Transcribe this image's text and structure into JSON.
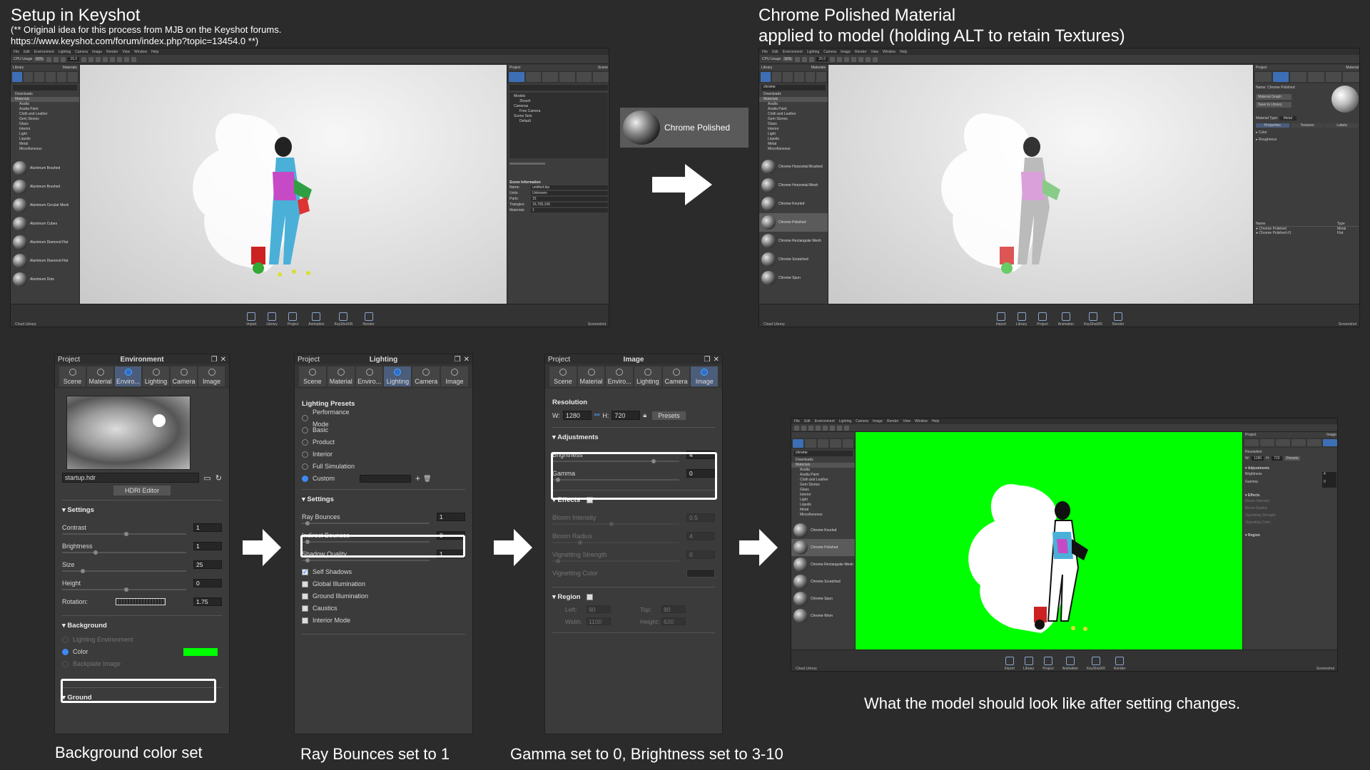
{
  "top_left": {
    "title": "Setup in Keyshot",
    "note_line1": "(** Original idea for this process from MJB on the Keyshot forums.",
    "note_line2": "https://www.keyshot.com/forum/index.php?topic=13454.0  **)"
  },
  "top_right": {
    "title_line1": "Chrome Polished Material",
    "title_line2": "applied to model (holding ALT to retain Textures)"
  },
  "material_chip": {
    "label": "Chrome Polished"
  },
  "app": {
    "menu": [
      "File",
      "Edit",
      "Environment",
      "Lighting",
      "Camera",
      "Image",
      "Render",
      "View",
      "Window",
      "Help"
    ],
    "cpu_label": "CPU Usage",
    "cpu_value": "50%",
    "fps": "25.0",
    "library_label": "Library",
    "materials_label": "Materials",
    "project_label": "Project",
    "scene_label": "Scene",
    "material_tab": "Material",
    "image_tab": "Image",
    "cloud_library": "Cloud Library",
    "screenshot": "Screenshot",
    "bottom_items": [
      "Import",
      "Library",
      "Project",
      "Animation",
      "KeyShotXR",
      "Render"
    ],
    "tree": [
      "Downloads",
      "Materials",
      "Axalta",
      "Axalta Paint",
      "Cloth and Leather",
      "Gem Stones",
      "Glass",
      "Interior",
      "Light",
      "Liquids",
      "Metal",
      "Miscellaneous"
    ],
    "thumbs_left": [
      "Aluminum Brushed",
      "Aluminum Brushed",
      "Aluminum Circular Mesh",
      "Aluminum Cubes",
      "Aluminum Diamond Flat",
      "Aluminum Diamond Flat",
      "Aluminum Dots"
    ],
    "thumbs_right": [
      "Chrome Horizontal Brushed",
      "Chrome Horizontal Mesh",
      "Chrome Knurled",
      "Chrome Polished",
      "Chrome Rectangular Mesh",
      "Chrome Scratched",
      "Chrome Spun"
    ],
    "thumbs_bottom": [
      "Chrome Knurled",
      "Chrome Polished",
      "Chrome Rectangular Mesh",
      "Chrome Scratched",
      "Chrome Spun",
      "Chrome Worn"
    ],
    "search_value": "chrome",
    "scene_info_title": "Scene Information",
    "scene_info": [
      {
        "k": "Name:",
        "v": "untitled.bip"
      },
      {
        "k": "Units:",
        "v": "Unknown"
      },
      {
        "k": "Parts:",
        "v": "15"
      },
      {
        "k": "Triangles:",
        "v": "16,700,106"
      },
      {
        "k": "Materials:",
        "v": "1"
      }
    ],
    "scene_tree": [
      "Models",
      "Zbrush",
      "Cameras",
      "Free Camera",
      "Scene Sets",
      "Default"
    ],
    "mat_name_label": "Name:",
    "mat_name": "Chrome Polished",
    "material_graph": "Material Graph",
    "save_to_library": "Save to Library",
    "material_type_label": "Material Type:",
    "material_type": "Metal",
    "mat_subtabs": [
      "Properties",
      "Textures",
      "Labels"
    ],
    "mat_props": [
      "Color",
      "Roughness"
    ],
    "mat_list_headers": [
      "Name",
      "Type"
    ],
    "mat_list": [
      {
        "name": "Chrome Polished",
        "type": "Metal"
      },
      {
        "name": "Chrome Polished #1",
        "type": "Flat"
      }
    ]
  },
  "environment_panel": {
    "header_left": "Project",
    "title": "Environment",
    "tabs": [
      "Scene",
      "Material",
      "Enviro...",
      "Lighting",
      "Camera",
      "Image"
    ],
    "active_tab": 2,
    "hdri_file": "startup.hdr",
    "hdri_editor": "HDRI Editor",
    "settings_label": "Settings",
    "fields": [
      {
        "label": "Contrast",
        "value": "1"
      },
      {
        "label": "Brightness",
        "value": "1"
      },
      {
        "label": "Size",
        "value": "25"
      },
      {
        "label": "Height",
        "value": "0"
      },
      {
        "label": "Rotation:",
        "value": "1.75"
      }
    ],
    "background_label": "Background",
    "bg_options": [
      "Lighting Environment",
      "Color",
      "Backplate Image"
    ],
    "bg_color": "#00ff00",
    "ground_label": "Ground",
    "caption": "Background color set"
  },
  "lighting_panel": {
    "header_left": "Project",
    "title": "Lighting",
    "tabs": [
      "Scene",
      "Material",
      "Enviro...",
      "Lighting",
      "Camera",
      "Image"
    ],
    "active_tab": 3,
    "presets_label": "Lighting Presets",
    "presets": [
      "Performance Mode",
      "Basic",
      "Product",
      "Interior",
      "Full Simulation",
      "Custom"
    ],
    "selected_preset": "Custom",
    "settings_label": "Settings",
    "fields": [
      {
        "label": "Ray Bounces",
        "value": "1"
      },
      {
        "label": "Indirect Bounces",
        "value": "0"
      },
      {
        "label": "Shadow Quality",
        "value": "1"
      }
    ],
    "checks": [
      {
        "label": "Self Shadows",
        "on": true
      },
      {
        "label": "Global Illumination",
        "on": false
      },
      {
        "label": "Ground Illumination",
        "on": false
      },
      {
        "label": "Caustics",
        "on": false
      },
      {
        "label": "Interior Mode",
        "on": false
      }
    ],
    "caption": "Ray Bounces set to 1"
  },
  "image_panel": {
    "header_left": "Project",
    "title": "Image",
    "tabs": [
      "Scene",
      "Material",
      "Enviro...",
      "Lighting",
      "Camera",
      "Image"
    ],
    "active_tab": 5,
    "resolution_label": "Resolution",
    "w_label": "W:",
    "w_value": "1280",
    "h_label": "H:",
    "h_value": "720",
    "presets_button": "Presets",
    "adjustments_label": "Adjustments",
    "fields": [
      {
        "label": "Brightness",
        "value": "4"
      },
      {
        "label": "Gamma",
        "value": "0"
      }
    ],
    "effects_label": "Effects",
    "effects": [
      {
        "label": "Bloom Intensity",
        "value": "0.5"
      },
      {
        "label": "Bloom Radius",
        "value": "4"
      },
      {
        "label": "Vignetting Strength",
        "value": "0"
      },
      {
        "label": "Vignetting Color",
        "value": ""
      }
    ],
    "region_label": "Region",
    "region": [
      {
        "k": "Left:",
        "v": "90"
      },
      {
        "k": "Top:",
        "v": "80"
      },
      {
        "k": "Width:",
        "v": "1100"
      },
      {
        "k": "Height:",
        "v": "620"
      }
    ],
    "caption": "Gamma set to 0, Brightness set to 3-10"
  },
  "result": {
    "caption": "What the model should look like after setting changes."
  },
  "colors": {
    "bg": "#2b2b2b",
    "accent": "#3d8af5",
    "green": "#00ff00",
    "highlight": "#ffffff"
  }
}
